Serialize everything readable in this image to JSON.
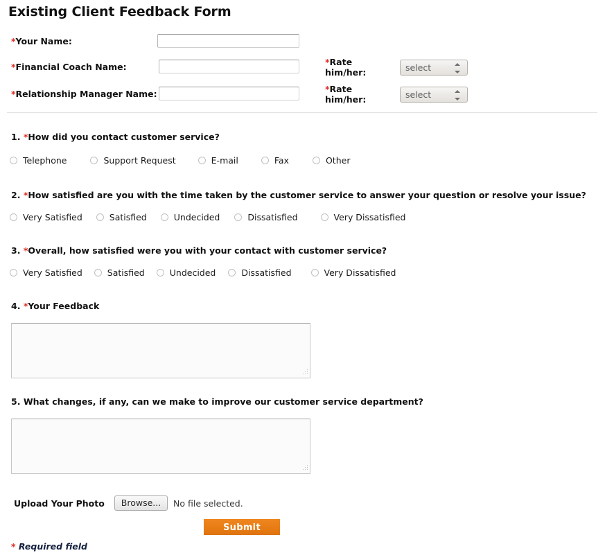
{
  "form": {
    "title": "Existing Client Feedback Form",
    "required_marker": "*",
    "footer_note": "Required field"
  },
  "identity_fields": [
    {
      "label": "Your Name:",
      "required": true,
      "value": "",
      "placeholder": ""
    },
    {
      "label": "Financial Coach Name:",
      "required": true,
      "value": "",
      "placeholder": ""
    },
    {
      "label": "Relationship Manager Name:",
      "required": true,
      "value": "",
      "placeholder": ""
    }
  ],
  "rate_fields": [
    {
      "label_line1": "Rate",
      "label_line2": "him/her:",
      "required": true,
      "selected": "select"
    },
    {
      "label_line1": "Rate",
      "label_line2": "him/her:",
      "required": true,
      "selected": "select"
    }
  ],
  "questions": [
    {
      "number": "1.",
      "text": "How did you contact customer service?",
      "required": true,
      "type": "radio",
      "options": [
        "Telephone",
        "Support Request",
        "E-mail",
        "Fax",
        "Other"
      ]
    },
    {
      "number": "2.",
      "text": "How satisfied are you with the time taken by the customer service to answer your question or resolve your issue?",
      "required": true,
      "type": "radio",
      "options": [
        "Very Satisfied",
        "Satisfied",
        "Undecided",
        "Dissatisfied",
        "Very Dissatisfied"
      ]
    },
    {
      "number": "3.",
      "text": "Overall, how satisfied were you with your contact with customer service?",
      "required": true,
      "type": "radio",
      "options": [
        "Very Satisfied",
        "Satisfied",
        "Undecided",
        "Dissatisfied",
        "Very Dissatisfied"
      ]
    },
    {
      "number": "4.",
      "text": "Your Feedback",
      "required": true,
      "type": "textarea",
      "value": ""
    },
    {
      "number": "5.",
      "text": "What changes, if any, can we make to improve our customer service department?",
      "required": false,
      "type": "textarea",
      "value": ""
    }
  ],
  "upload": {
    "label": "Upload Your Photo",
    "browse_label": "Browse...",
    "status": "No file selected."
  },
  "submit": {
    "label": "Submit"
  },
  "colors": {
    "accent_orange": "#e87c14",
    "required_red": "#e02b20",
    "footer_text": "#16213f",
    "divider": "#e2e2e2"
  }
}
